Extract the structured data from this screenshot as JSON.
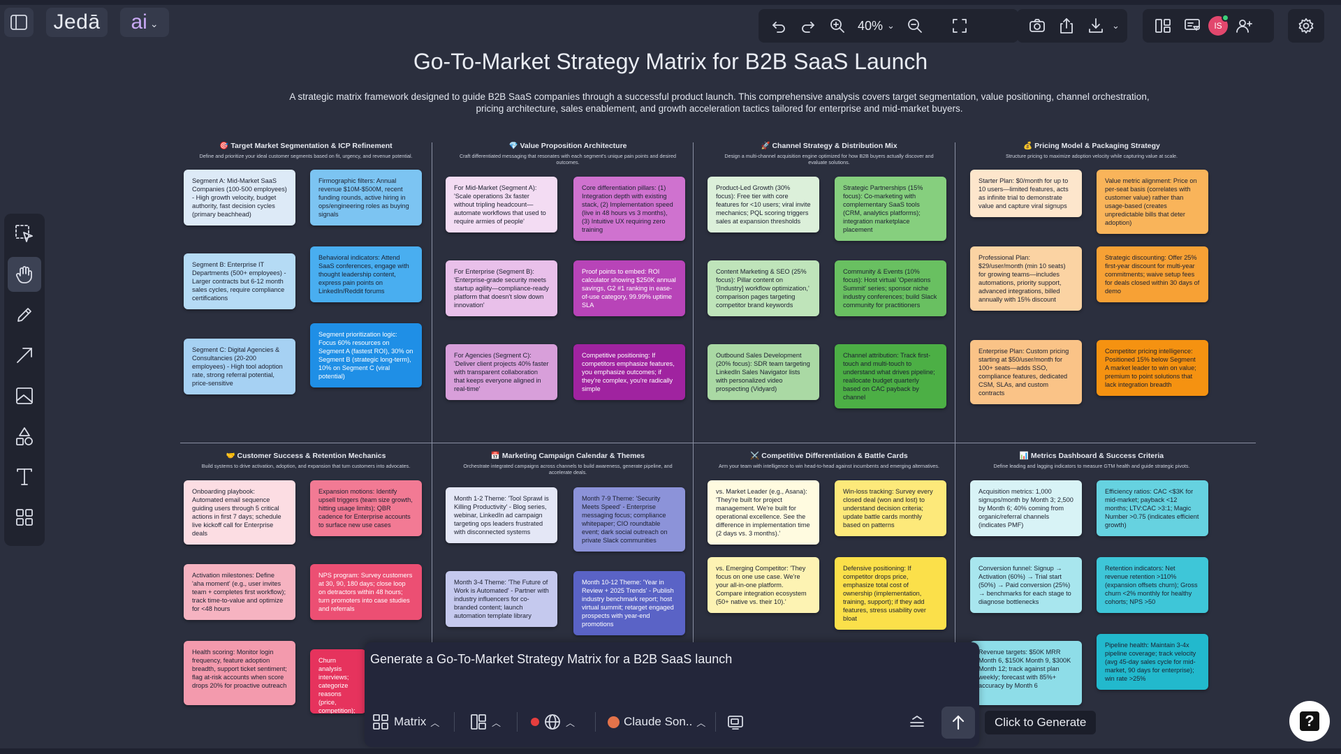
{
  "app": {
    "brand": "Jedā",
    "ai_label": "ai"
  },
  "toolbar": {
    "zoom": "40%",
    "avatar_initials": "IS"
  },
  "canvas": {
    "title": "Go-To-Market Strategy Matrix for B2B SaaS Launch",
    "description": "A strategic matrix framework designed to guide B2B SaaS companies through a successful product launch. This comprehensive analysis covers target segmentation, value positioning, channel orchestration, pricing architecture, sales enablement, and growth acceleration tactics tailored for enterprise and mid-market buyers."
  },
  "sections": [
    {
      "icon": "🎯",
      "title": "Target Market Segmentation & ICP Refinement",
      "subtitle": "Define and prioritize your ideal customer segments based on fit, urgency, and revenue potential.",
      "notes": [
        {
          "text": "Segment A: Mid-Market SaaS Companies (100-500 employees) - High growth velocity, budget authority, fast decision cycles (primary beachhead)",
          "color": "#ddeaf7"
        },
        {
          "text": "Firmographic filters: Annual revenue $10M-$500M, recent funding rounds, active hiring in ops/engineering roles as buying signals",
          "color": "#7cc4f2"
        },
        {
          "text": "Segment B: Enterprise IT Departments (500+ employees) - Larger contracts but 6-12 month sales cycles, require compliance certifications",
          "color": "#b5dbf5"
        },
        {
          "text": "Behavioral indicators: Attend SaaS conferences, engage with thought leadership content, express pain points on LinkedIn/Reddit forums",
          "color": "#49aef0"
        },
        {
          "text": "Segment C: Digital Agencies & Consultancies (20-200 employees) - High tool adoption rate, strong referral potential, price-sensitive",
          "color": "#a6d1f3"
        },
        {
          "text": "Segment prioritization logic: Focus 60% resources on Segment A (fastest ROI), 30% on Segment B (strategic long-term), 10% on Segment C (viral potential)",
          "color": "#1f8fe6"
        }
      ]
    },
    {
      "icon": "💎",
      "title": "Value Proposition Architecture",
      "subtitle": "Craft differentiated messaging that resonates with each segment's unique pain points and desired outcomes.",
      "notes": [
        {
          "text": "For Mid-Market (Segment A): 'Scale operations 3x faster without tripling headcount—automate workflows that used to require armies of people'",
          "color": "#f3dcf3"
        },
        {
          "text": "Core differentiation pillars: (1) Integration depth with existing stack, (2) Implementation speed (live in 48 hours vs 3 months), (3) Intuitive UX requiring zero training",
          "color": "#cf72cf"
        },
        {
          "text": "For Enterprise (Segment B): 'Enterprise-grade security meets startup agility—compliance-ready platform that doesn't slow down innovation'",
          "color": "#e9c0ea"
        },
        {
          "text": "Proof points to embed: ROI calculator showing $250K annual savings, G2 #1 ranking in ease-of-use category, 99.99% uptime SLA",
          "color": "#b844b8"
        },
        {
          "text": "For Agencies (Segment C): 'Deliver client projects 40% faster with transparent collaboration that keeps everyone aligned in real-time'",
          "color": "#d89fda"
        },
        {
          "text": "Competitive positioning: If competitors emphasize features, you emphasize outcomes; if they're complex, you're radically simple",
          "color": "#a023a0"
        }
      ]
    },
    {
      "icon": "🚀",
      "title": "Channel Strategy & Distribution Mix",
      "subtitle": "Design a multi-channel acquisition engine optimized for how B2B buyers actually discover and evaluate solutions.",
      "notes": [
        {
          "text": "Product-Led Growth (30% focus): Free tier with core features for <10 users; viral invite mechanics; PQL scoring triggers sales at expansion thresholds",
          "color": "#dcf0da"
        },
        {
          "text": "Strategic Partnerships (15% focus): Co-marketing with complementary SaaS tools (CRM, analytics platforms); integration marketplace placement",
          "color": "#86cf7e"
        },
        {
          "text": "Content Marketing & SEO (25% focus): Pillar content on '[Industry] workflow optimization,' comparison pages targeting competitor brand keywords",
          "color": "#bfe4ba"
        },
        {
          "text": "Community & Events (10% focus): Host virtual 'Operations Summit' series; sponsor niche industry conferences; build Slack community for practitioners",
          "color": "#69c061"
        },
        {
          "text": "Outbound Sales Development (20% focus): SDR team targeting LinkedIn Sales Navigator lists with personalized video prospecting (Vidyard)",
          "color": "#aad9a4"
        },
        {
          "text": "Channel attribution: Track first-touch and multi-touch to understand what drives pipeline; reallocate budget quarterly based on CAC payback by channel",
          "color": "#4caf45"
        }
      ]
    },
    {
      "icon": "💰",
      "title": "Pricing Model & Packaging Strategy",
      "subtitle": "Structure pricing to maximize adoption velocity while capturing value at scale.",
      "notes": [
        {
          "text": "Starter Plan: $0/month for up to 10 users—limited features, acts as infinite trial to demonstrate value and capture viral signups",
          "color": "#fde6cc"
        },
        {
          "text": "Value metric alignment: Price on per-seat basis (correlates with customer value) rather than usage-based (creates unpredictable bills that deter adoption)",
          "color": "#f9b45a"
        },
        {
          "text": "Professional Plan: $29/user/month (min 10 seats) for growing teams—includes automations, priority support, advanced integrations, billed annually with 15% discount",
          "color": "#fbd3a3"
        },
        {
          "text": "Strategic discounting: Offer 25% first-year discount for multi-year commitments; waive setup fees for deals closed within 30 days of demo",
          "color": "#f7a135"
        },
        {
          "text": "Enterprise Plan: Custom pricing starting at $50/user/month for 100+ seats—adds SSO, compliance features, dedicated CSM, SLAs, and custom contracts",
          "color": "#fac387"
        },
        {
          "text": "Competitor pricing intelligence: Positioned 15% below Segment A market leader to win on value; premium to point solutions that lack integration breadth",
          "color": "#f59211"
        }
      ]
    },
    {
      "icon": "🤝",
      "title": "Customer Success & Retention Mechanics",
      "subtitle": "Build systems to drive activation, adoption, and expansion that turn customers into advocates.",
      "notes": [
        {
          "text": "Onboarding playbook: Automated email sequence guiding users through 5 critical actions in first 7 days; schedule live kickoff call for Enterprise deals",
          "color": "#fcdde3"
        },
        {
          "text": "Expansion motions: Identify upsell triggers (team size growth, hitting usage limits); QBR cadence for Enterprise accounts to surface new use cases",
          "color": "#f27a94"
        },
        {
          "text": "Activation milestones: Define 'aha moment' (e.g., user invites team + completes first workflow); track time-to-value and optimize for <48 hours",
          "color": "#f6b3c1"
        },
        {
          "text": "NPS program: Survey customers at 30, 90, 180 days; close loop on detractors within 48 hours; turn promoters into case studies and referrals",
          "color": "#ec4f73"
        },
        {
          "text": "Health scoring: Monitor login frequency, feature adoption breadth, support ticket sentiment; flag at-risk accounts when score drops 20% for proactive outreach",
          "color": "#f39aad"
        },
        {
          "text": "Churn analysis interviews; categorize reasons (price, competition); back to product teams quarterly",
          "color": "#e6335d"
        }
      ]
    },
    {
      "icon": "📅",
      "title": "Marketing Campaign Calendar & Themes",
      "subtitle": "Orchestrate integrated campaigns across channels to build awareness, generate pipeline, and accelerate deals.",
      "notes": [
        {
          "text": "Month 1-2 Theme: 'Tool Sprawl is Killing Productivity' - Blog series, webinar, LinkedIn ad campaign targeting ops leaders frustrated with disconnected systems",
          "color": "#e4e7f6"
        },
        {
          "text": "Month 7-9 Theme: 'Security Meets Speed' - Enterprise messaging focus; compliance whitepaper; CIO roundtable event; dark social outreach on private Slack communities",
          "color": "#8c93d9"
        },
        {
          "text": "Month 3-4 Theme: 'The Future of Work is Automated' - Partner with industry influencers for co-branded content; launch automation template library",
          "color": "#c5c9ee"
        },
        {
          "text": "Month 10-12 Theme: 'Year in Review + 2025 Trends' - Publish industry benchmark report; host virtual summit; retarget engaged prospects with year-end promotions",
          "color": "#5a63c6"
        }
      ]
    },
    {
      "icon": "⚔️",
      "title": "Competitive Differentiation & Battle Cards",
      "subtitle": "Arm your team with intelligence to win head-to-head against incumbents and emerging alternatives.",
      "notes": [
        {
          "text": "vs. Market Leader (e.g., Asana): 'They're built for project management. We're built for operational excellence. See the difference in implementation time (2 days vs. 3 months).'",
          "color": "#fffbe0"
        },
        {
          "text": "Win-loss tracking: Survey every closed deal (won and lost) to understand decision criteria; update battle cards monthly based on patterns",
          "color": "#fde97a"
        },
        {
          "text": "vs. Emerging Competitor: 'They focus on one use case. We're your all-in-one platform. Compare integration ecosystem (50+ native vs. their 10).'",
          "color": "#fdf3b3"
        },
        {
          "text": "Defensive positioning: If competitor drops price, emphasize total cost of ownership (implementation, training, support); if they add features, stress usability over bloat",
          "color": "#fbe04a"
        }
      ]
    },
    {
      "icon": "📊",
      "title": "Metrics Dashboard & Success Criteria",
      "subtitle": "Define leading and lagging indicators to measure GTM health and guide strategic pivots.",
      "notes": [
        {
          "text": "Acquisition metrics: 1,000 signups/month by Month 3; 2,500 by Month 6; 40% coming from organic/referral channels (indicates PMF)",
          "color": "#d8f3f6"
        },
        {
          "text": "Efficiency ratios: CAC <$3K for mid-market; payback <12 months; LTV:CAC >3:1; Magic Number >0.75 (indicates efficient growth)",
          "color": "#66d2e0"
        },
        {
          "text": "Conversion funnel: Signup → Activation (60%) → Trial start (50%) → Paid conversion (25%) → benchmarks for each stage to diagnose bottlenecks",
          "color": "#a8e6ee"
        },
        {
          "text": "Retention indicators: Net revenue retention >110% (expansion offsets churn); Gross churn <2% monthly for healthy cohorts; NPS >50",
          "color": "#3ec6d8"
        },
        {
          "text": "Revenue targets: $50K MRR Month 6, $150K Month 9, $300K Month 12; track against plan weekly; forecast with 85%+ accuracy by Month 6",
          "color": "#8edde8"
        },
        {
          "text": "Pipeline health: Maintain 3-4x pipeline coverage; track velocity (avg 45-day sales cycle for mid-market, 90 days for enterprise); win rate >25%",
          "color": "#22b9cd"
        }
      ]
    }
  ],
  "prompt": {
    "text": "Generate a Go-To-Market Strategy Matrix for a B2B SaaS launch",
    "layout_label": "Matrix",
    "model_label": "Claude Son..",
    "generate_tooltip": "Click to Generate"
  }
}
